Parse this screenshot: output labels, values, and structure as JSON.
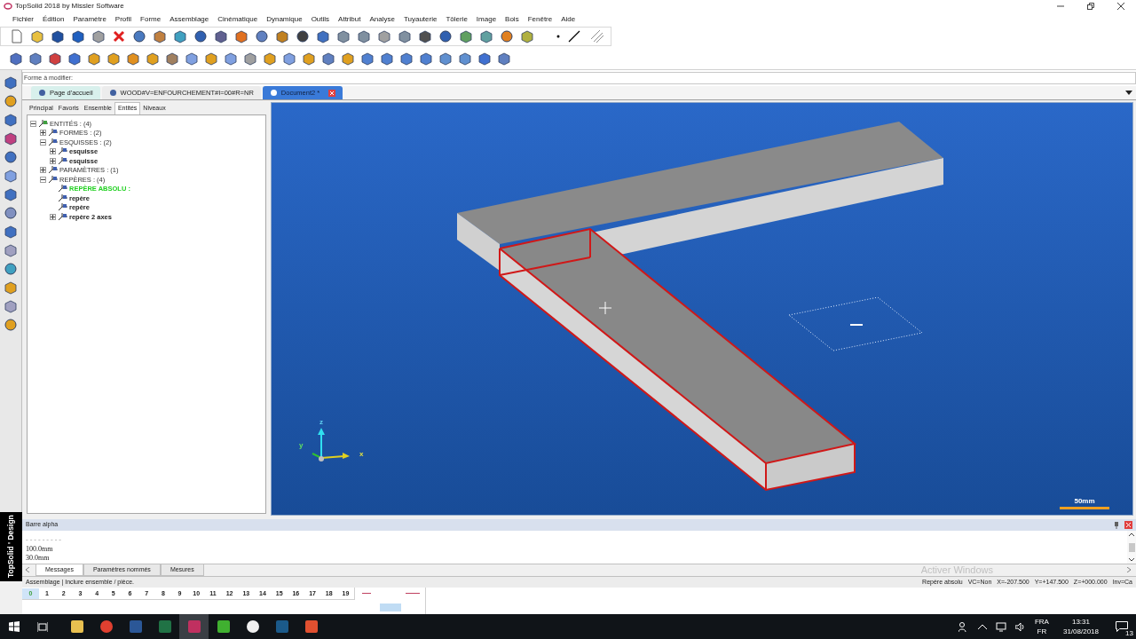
{
  "window": {
    "title": "TopSolid 2018 by Missler Software"
  },
  "menu": [
    "Fichier",
    "Édition",
    "Paramètre",
    "Profil",
    "Forme",
    "Assemblage",
    "Cinématique",
    "Dynamique",
    "Outils",
    "Attribut",
    "Analyse",
    "Tuyauterie",
    "Tôlerie",
    "Image",
    "Bois",
    "Fenêtre",
    "Aide"
  ],
  "prompt": {
    "label": "Forme à modifier:"
  },
  "doc_tabs": [
    {
      "label": "Page d'accueil",
      "selected": false
    },
    {
      "label": "WOOD#V=ENFOURCHEMENT#I=00#R=NR",
      "selected": false
    },
    {
      "label": "Document2 *",
      "selected": true
    }
  ],
  "panel_tabs": [
    {
      "label": "Principal",
      "selected": false
    },
    {
      "label": "Favoris",
      "selected": false
    },
    {
      "label": "Ensemble",
      "selected": false
    },
    {
      "label": "Entités",
      "selected": true
    },
    {
      "label": "Niveaux",
      "selected": false
    }
  ],
  "tree": [
    {
      "label": "ENTITÉS : (4)",
      "expanded": true,
      "current": false,
      "children": [
        {
          "label": "FORMES : (2)",
          "expanded": false,
          "current": false
        },
        {
          "label": "ESQUISSES : (2)",
          "expanded": true,
          "current": false,
          "children": [
            {
              "label": "esquisse",
              "expanded": false,
              "current": false
            },
            {
              "label": "esquisse",
              "expanded": false,
              "current": false
            }
          ]
        },
        {
          "label": "PARAMÈTRES : (1)",
          "expanded": false,
          "current": false
        },
        {
          "label": "REPÈRES : (4)",
          "expanded": true,
          "current": false,
          "children": [
            {
              "label": "REPÈRE ABSOLU :",
              "current": true
            },
            {
              "label": "repère",
              "current": false
            },
            {
              "label": "repère",
              "current": false
            },
            {
              "label": "repère 2 axes",
              "expanded": false,
              "current": false
            }
          ]
        }
      ]
    }
  ],
  "viewport": {
    "axes": [
      "z",
      "y",
      "x"
    ],
    "scale": "50mm"
  },
  "side_label": "TopSolid ' Design",
  "alpha_bar": {
    "title": "Barre alpha",
    "lines": [
      "- - - - - - - - -",
      "100.0mm",
      "30.0mm"
    ]
  },
  "message_tabs": [
    {
      "label": "Messages",
      "selected": true
    },
    {
      "label": "Paramètres nommés",
      "selected": false
    },
    {
      "label": "Mesures",
      "selected": false
    }
  ],
  "status": {
    "message": "Assemblage | Inclure ensemble / pièce.",
    "watermark": "Activer Windows",
    "fields": [
      "Repère absolu",
      "VC=Non",
      "X=-207.500",
      "Y=+147.500",
      "Z=+000.000",
      "Inv=Ca"
    ]
  },
  "layers": [
    {
      "label": "0",
      "selected": true
    },
    {
      "label": "1",
      "selected": false
    },
    {
      "label": "2",
      "selected": false
    },
    {
      "label": "3",
      "selected": false
    },
    {
      "label": "4",
      "selected": false
    },
    {
      "label": "5",
      "selected": false
    },
    {
      "label": "6",
      "selected": false
    },
    {
      "label": "7",
      "selected": false
    },
    {
      "label": "8",
      "selected": false
    },
    {
      "label": "9",
      "selected": false
    },
    {
      "label": "10",
      "selected": false
    },
    {
      "label": "11",
      "selected": false
    },
    {
      "label": "12",
      "selected": false
    },
    {
      "label": "13",
      "selected": false
    },
    {
      "label": "14",
      "selected": false
    },
    {
      "label": "15",
      "selected": false
    },
    {
      "label": "16",
      "selected": false
    },
    {
      "label": "17",
      "selected": false
    },
    {
      "label": "18",
      "selected": false
    },
    {
      "label": "19",
      "selected": false
    }
  ],
  "taskbar": {
    "language": "FRA",
    "layout": "FR",
    "time": "13:31",
    "date": "31/08/2018",
    "notifications": "13"
  }
}
